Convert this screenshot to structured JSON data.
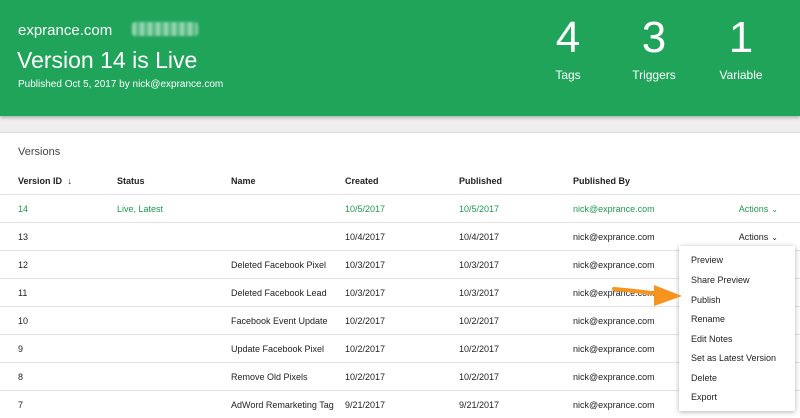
{
  "header": {
    "domain": "exprance.com",
    "title": "Version 14 is Live",
    "published_line": "Published Oct 5, 2017 by nick@exprance.com",
    "stats": [
      {
        "value": "4",
        "label": "Tags"
      },
      {
        "value": "3",
        "label": "Triggers"
      },
      {
        "value": "1",
        "label": "Variable"
      }
    ]
  },
  "versions": {
    "title": "Versions",
    "columns": {
      "version_id": "Version ID",
      "sort_arrow": "↓",
      "status": "Status",
      "name": "Name",
      "created": "Created",
      "published": "Published",
      "published_by": "Published By"
    },
    "rows": [
      {
        "id": "14",
        "status": "Live, Latest",
        "name": "",
        "created": "10/5/2017",
        "published": "10/5/2017",
        "by": "nick@exprance.com",
        "actions": "Actions"
      },
      {
        "id": "13",
        "status": "",
        "name": "",
        "created": "10/4/2017",
        "published": "10/4/2017",
        "by": "nick@exprance.com",
        "actions": "Actions"
      },
      {
        "id": "12",
        "status": "",
        "name": "Deleted Facebook Pixel",
        "created": "10/3/2017",
        "published": "10/3/2017",
        "by": "nick@exprance.com",
        "actions": ""
      },
      {
        "id": "11",
        "status": "",
        "name": "Deleted Facebook Lead",
        "created": "10/3/2017",
        "published": "10/3/2017",
        "by": "nick@exprance.com",
        "actions": ""
      },
      {
        "id": "10",
        "status": "",
        "name": "Facebook Event Update",
        "created": "10/2/2017",
        "published": "10/2/2017",
        "by": "nick@exprance.com",
        "actions": ""
      },
      {
        "id": "9",
        "status": "",
        "name": "Update Facebook Pixel",
        "created": "10/2/2017",
        "published": "10/2/2017",
        "by": "nick@exprance.com",
        "actions": ""
      },
      {
        "id": "8",
        "status": "",
        "name": "Remove Old Pixels",
        "created": "10/2/2017",
        "published": "10/2/2017",
        "by": "nick@exprance.com",
        "actions": ""
      },
      {
        "id": "7",
        "status": "",
        "name": "AdWord Remarketing Tag",
        "created": "9/21/2017",
        "published": "9/21/2017",
        "by": "nick@exprance.com",
        "actions": ""
      }
    ]
  },
  "actions_menu": {
    "items": [
      "Preview",
      "Share Preview",
      "Publish",
      "Rename",
      "Edit Notes",
      "Set as Latest Version",
      "Delete",
      "Export"
    ]
  },
  "colors": {
    "brand_green": "#1fa45a",
    "link_green": "#1d9b4f",
    "annotation_arrow": "#f7941d"
  },
  "icons": {
    "sort": "arrow-down-icon",
    "actions": "chevron-down-icon",
    "annotation": "orange-arrow-icon"
  }
}
